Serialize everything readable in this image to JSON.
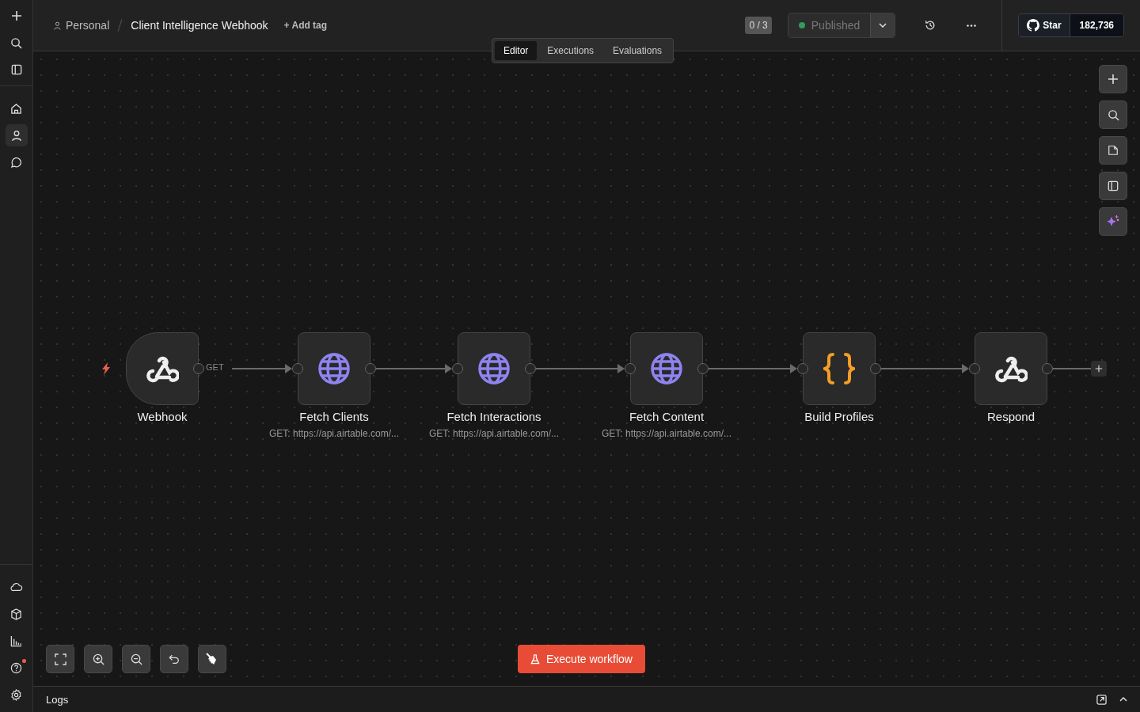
{
  "sidebar": {
    "top_items": [
      {
        "kind": "plus",
        "selected": false
      },
      {
        "kind": "search",
        "selected": false
      },
      {
        "kind": "panel",
        "selected": false
      }
    ],
    "nav_items": [
      {
        "kind": "home",
        "selected": false
      },
      {
        "kind": "person",
        "selected": true
      },
      {
        "kind": "chat",
        "selected": false
      }
    ],
    "bottom_items": [
      {
        "kind": "cloud",
        "badge": false
      },
      {
        "kind": "box",
        "badge": false
      },
      {
        "kind": "chart",
        "badge": false
      },
      {
        "kind": "help",
        "badge": true
      },
      {
        "kind": "gear",
        "badge": false
      }
    ]
  },
  "header": {
    "breadcrumb": {
      "project": "Personal",
      "workflow": "Client Intelligence Webhook"
    },
    "add_tag": "+ Add tag",
    "tabs": [
      {
        "label": "Editor",
        "selected": true
      },
      {
        "label": "Executions",
        "selected": false
      },
      {
        "label": "Evaluations",
        "selected": false
      }
    ],
    "counter": "0 / 3",
    "status": {
      "label": "Published",
      "color": "#2e9e5b"
    },
    "github": {
      "label": "Star",
      "count": "182,736"
    }
  },
  "nodes": [
    {
      "kind": "trigger",
      "name": "Webhook",
      "output_label": "GET"
    },
    {
      "kind": "http",
      "name": "Fetch Clients",
      "subtitle": "GET: https://api.airtable.com/..."
    },
    {
      "kind": "http",
      "name": "Fetch Interactions",
      "subtitle": "GET: https://api.airtable.com/..."
    },
    {
      "kind": "http",
      "name": "Fetch Content",
      "subtitle": "GET: https://api.airtable.com/..."
    },
    {
      "kind": "code",
      "name": "Build Profiles"
    },
    {
      "kind": "webhook",
      "name": "Respond"
    }
  ],
  "execute_button": "Execute workflow",
  "logs": {
    "label": "Logs"
  }
}
